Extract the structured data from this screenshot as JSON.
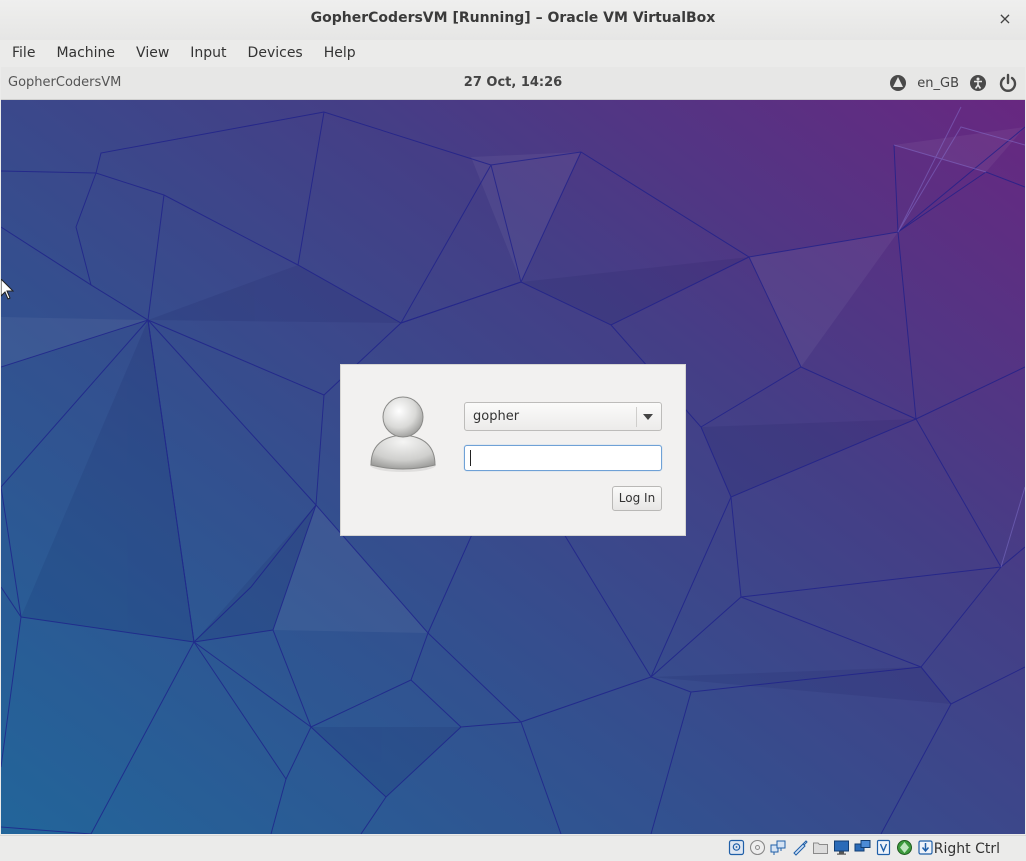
{
  "window": {
    "title": "GopherCodersVM [Running] – Oracle VM VirtualBox",
    "close_glyph": "×"
  },
  "menubar": {
    "items": [
      {
        "label": "File"
      },
      {
        "label": "Machine"
      },
      {
        "label": "View"
      },
      {
        "label": "Input"
      },
      {
        "label": "Devices"
      },
      {
        "label": "Help"
      }
    ]
  },
  "guest_topbar": {
    "hostname": "GopherCodersVM",
    "clock": "27 Oct, 14:26",
    "language": "en_GB",
    "icons": [
      "network-icon",
      "accessibility-icon",
      "power-icon"
    ]
  },
  "login": {
    "selected_user": "gopher",
    "password_value": "",
    "login_button": "Log In"
  },
  "statusbar": {
    "host_key": "Right Ctrl",
    "icons": [
      "hard-disk-icon",
      "optical-drive-icon",
      "audio-icon",
      "usb-icon",
      "shared-folders-icon",
      "display-icon",
      "network-adapter-icon",
      "video-capture-icon",
      "mouse-integration-icon",
      "keyboard-capture-icon",
      "host-key-arrow-icon"
    ]
  },
  "colors": {
    "wallpaper_teal": "#2d6a9f",
    "wallpaper_indigo": "#3a4a8e",
    "wallpaper_purple": "#6a2a82",
    "focus_border": "#6fa1d6"
  }
}
